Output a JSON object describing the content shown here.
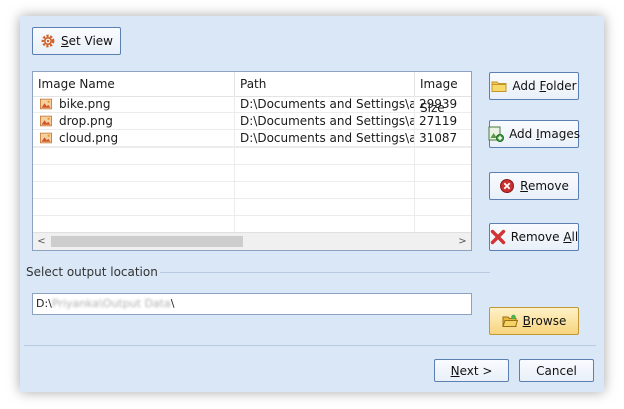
{
  "toolbar": {
    "set_view_label": "Set View",
    "set_view_mnemonic": "S",
    "set_view_rest": "et View"
  },
  "listview": {
    "columns": [
      "Image Name",
      "Path",
      "Image Size"
    ],
    "rows": [
      {
        "name": "bike.png",
        "path": "D:\\Documents and Settings\\am...",
        "size": "29939"
      },
      {
        "name": "drop.png",
        "path": "D:\\Documents and Settings\\am...",
        "size": "27119"
      },
      {
        "name": "cloud.png",
        "path": "D:\\Documents and Settings\\am...",
        "size": "31087"
      }
    ],
    "scroll_left": "<",
    "scroll_right": ">"
  },
  "side_buttons": {
    "add_folder": {
      "pre": "Add ",
      "u": "F",
      "post": "older"
    },
    "add_images": {
      "pre": "Add ",
      "u": "I",
      "post": "mages"
    },
    "remove": {
      "pre": "",
      "u": "R",
      "post": "emove"
    },
    "remove_all": {
      "pre": "Remove ",
      "u": "A",
      "post": "ll"
    },
    "browse": {
      "pre": "",
      "u": "B",
      "post": "rowse"
    }
  },
  "output": {
    "label": "Select output location",
    "value_prefix": "D:\\",
    "value_blurred": "Priyanka\\Output Data",
    "value_suffix": "\\"
  },
  "footer": {
    "next": {
      "u": "N",
      "post": "ext >"
    },
    "cancel": "Cancel"
  },
  "colors": {
    "accent_border": "#5b7fb0",
    "window_bg": "#d9e7f7",
    "browse_bg": "#f7d47d"
  }
}
